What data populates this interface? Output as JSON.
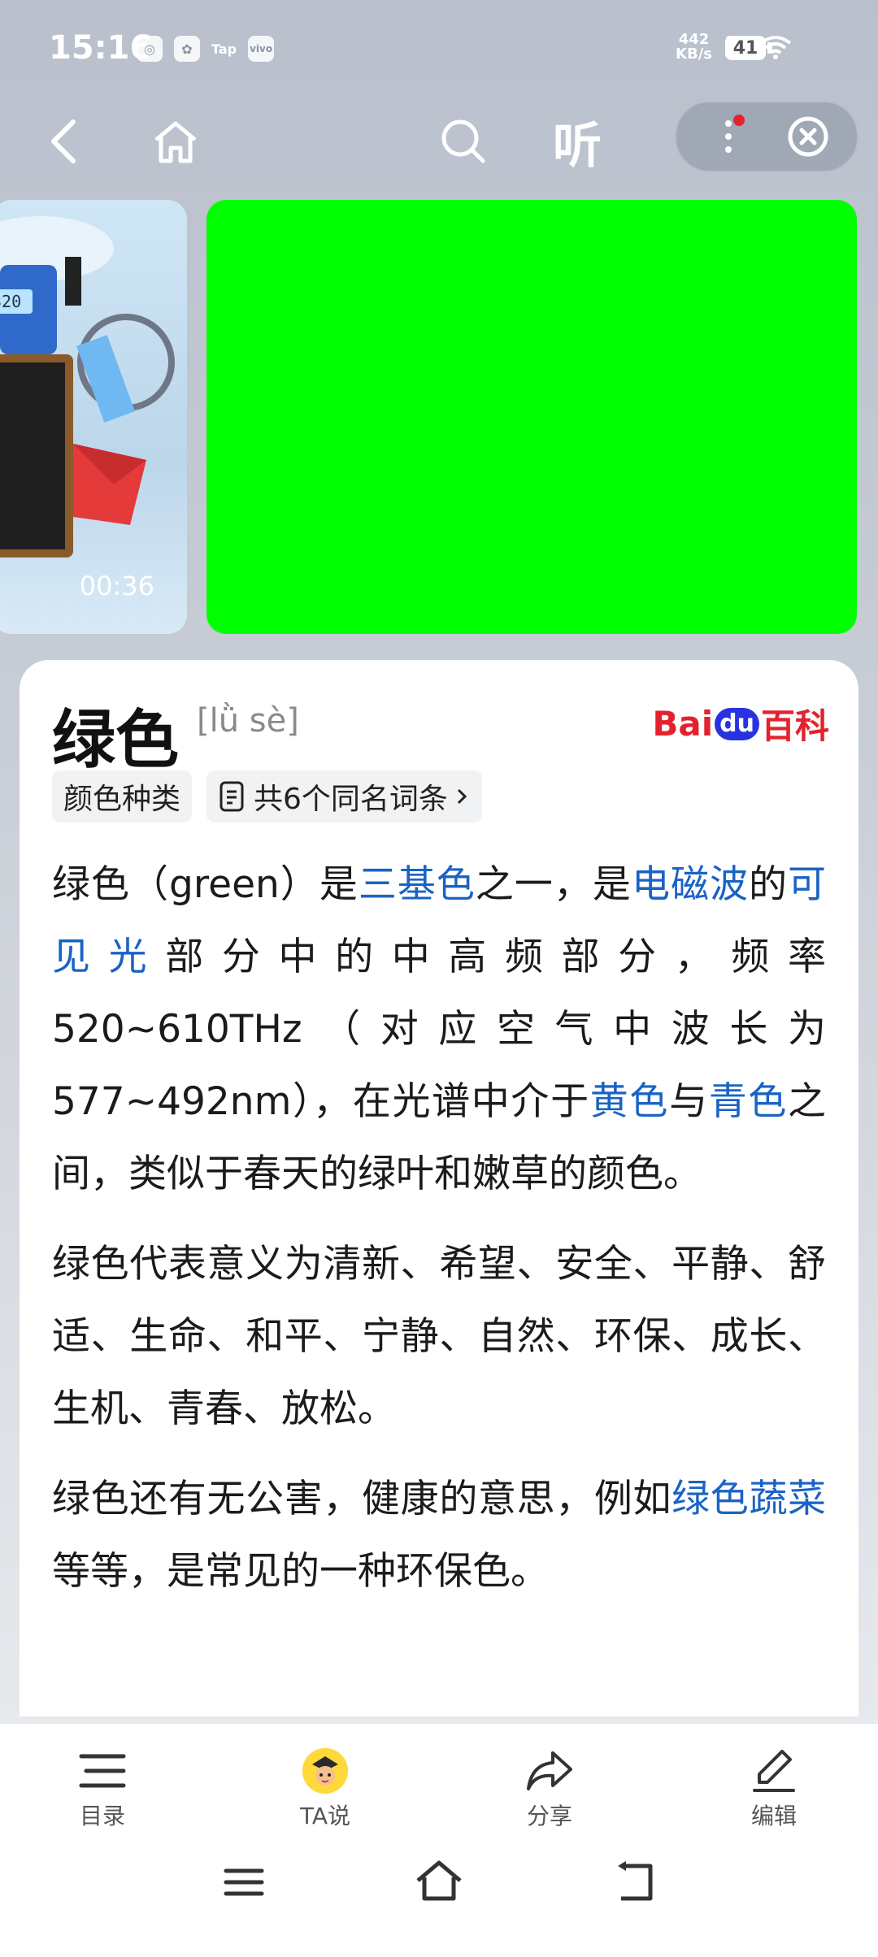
{
  "status_bar": {
    "time": "15:16",
    "app_icons": [
      "Tap",
      "vivo"
    ],
    "net_speed_value": "442",
    "net_speed_unit": "KB/s",
    "battery": "41"
  },
  "nav": {
    "listen_label": "听"
  },
  "media": {
    "video_duration": "00:36",
    "main_image_color": "#00ff00"
  },
  "entry": {
    "title": "绿色",
    "pinyin": "[lǜ sè]",
    "source_logo": {
      "text_bai": "Bai",
      "text_du": "du",
      "text_baike": "百科"
    },
    "tags": [
      "颜色种类",
      "共6个同名词条"
    ]
  },
  "paragraph1": {
    "t1": "绿色（green）是",
    "l1": "三基色",
    "t2": "之一，是",
    "l2": "电磁波",
    "t3": "的",
    "l3": "可见光",
    "t4": "部分中的中高频部分，频率520~610THz（对应空气中波长为577~492nm），在光谱中介于",
    "l4": "黄色",
    "t5": "与",
    "l5": "青色",
    "t6": "之间，类似于春天的绿叶和嫩草的颜色。"
  },
  "paragraph2": "绿色代表意义为清新、希望、安全、平静、舒适、生命、和平、宁静、自然、环保、成长、生机、青春、放松。",
  "paragraph3": {
    "t1": "绿色还有无公害，健康的意思，例如",
    "l1": "绿色蔬菜",
    "t2": "等等，是常见的一种环保色。"
  },
  "toolbar": {
    "items": [
      "目录",
      "TA说",
      "分享",
      "编辑"
    ]
  },
  "colors": {
    "link": "#1a63c4",
    "accent_red": "#e4222d",
    "baidu_blue": "#2932e1"
  }
}
